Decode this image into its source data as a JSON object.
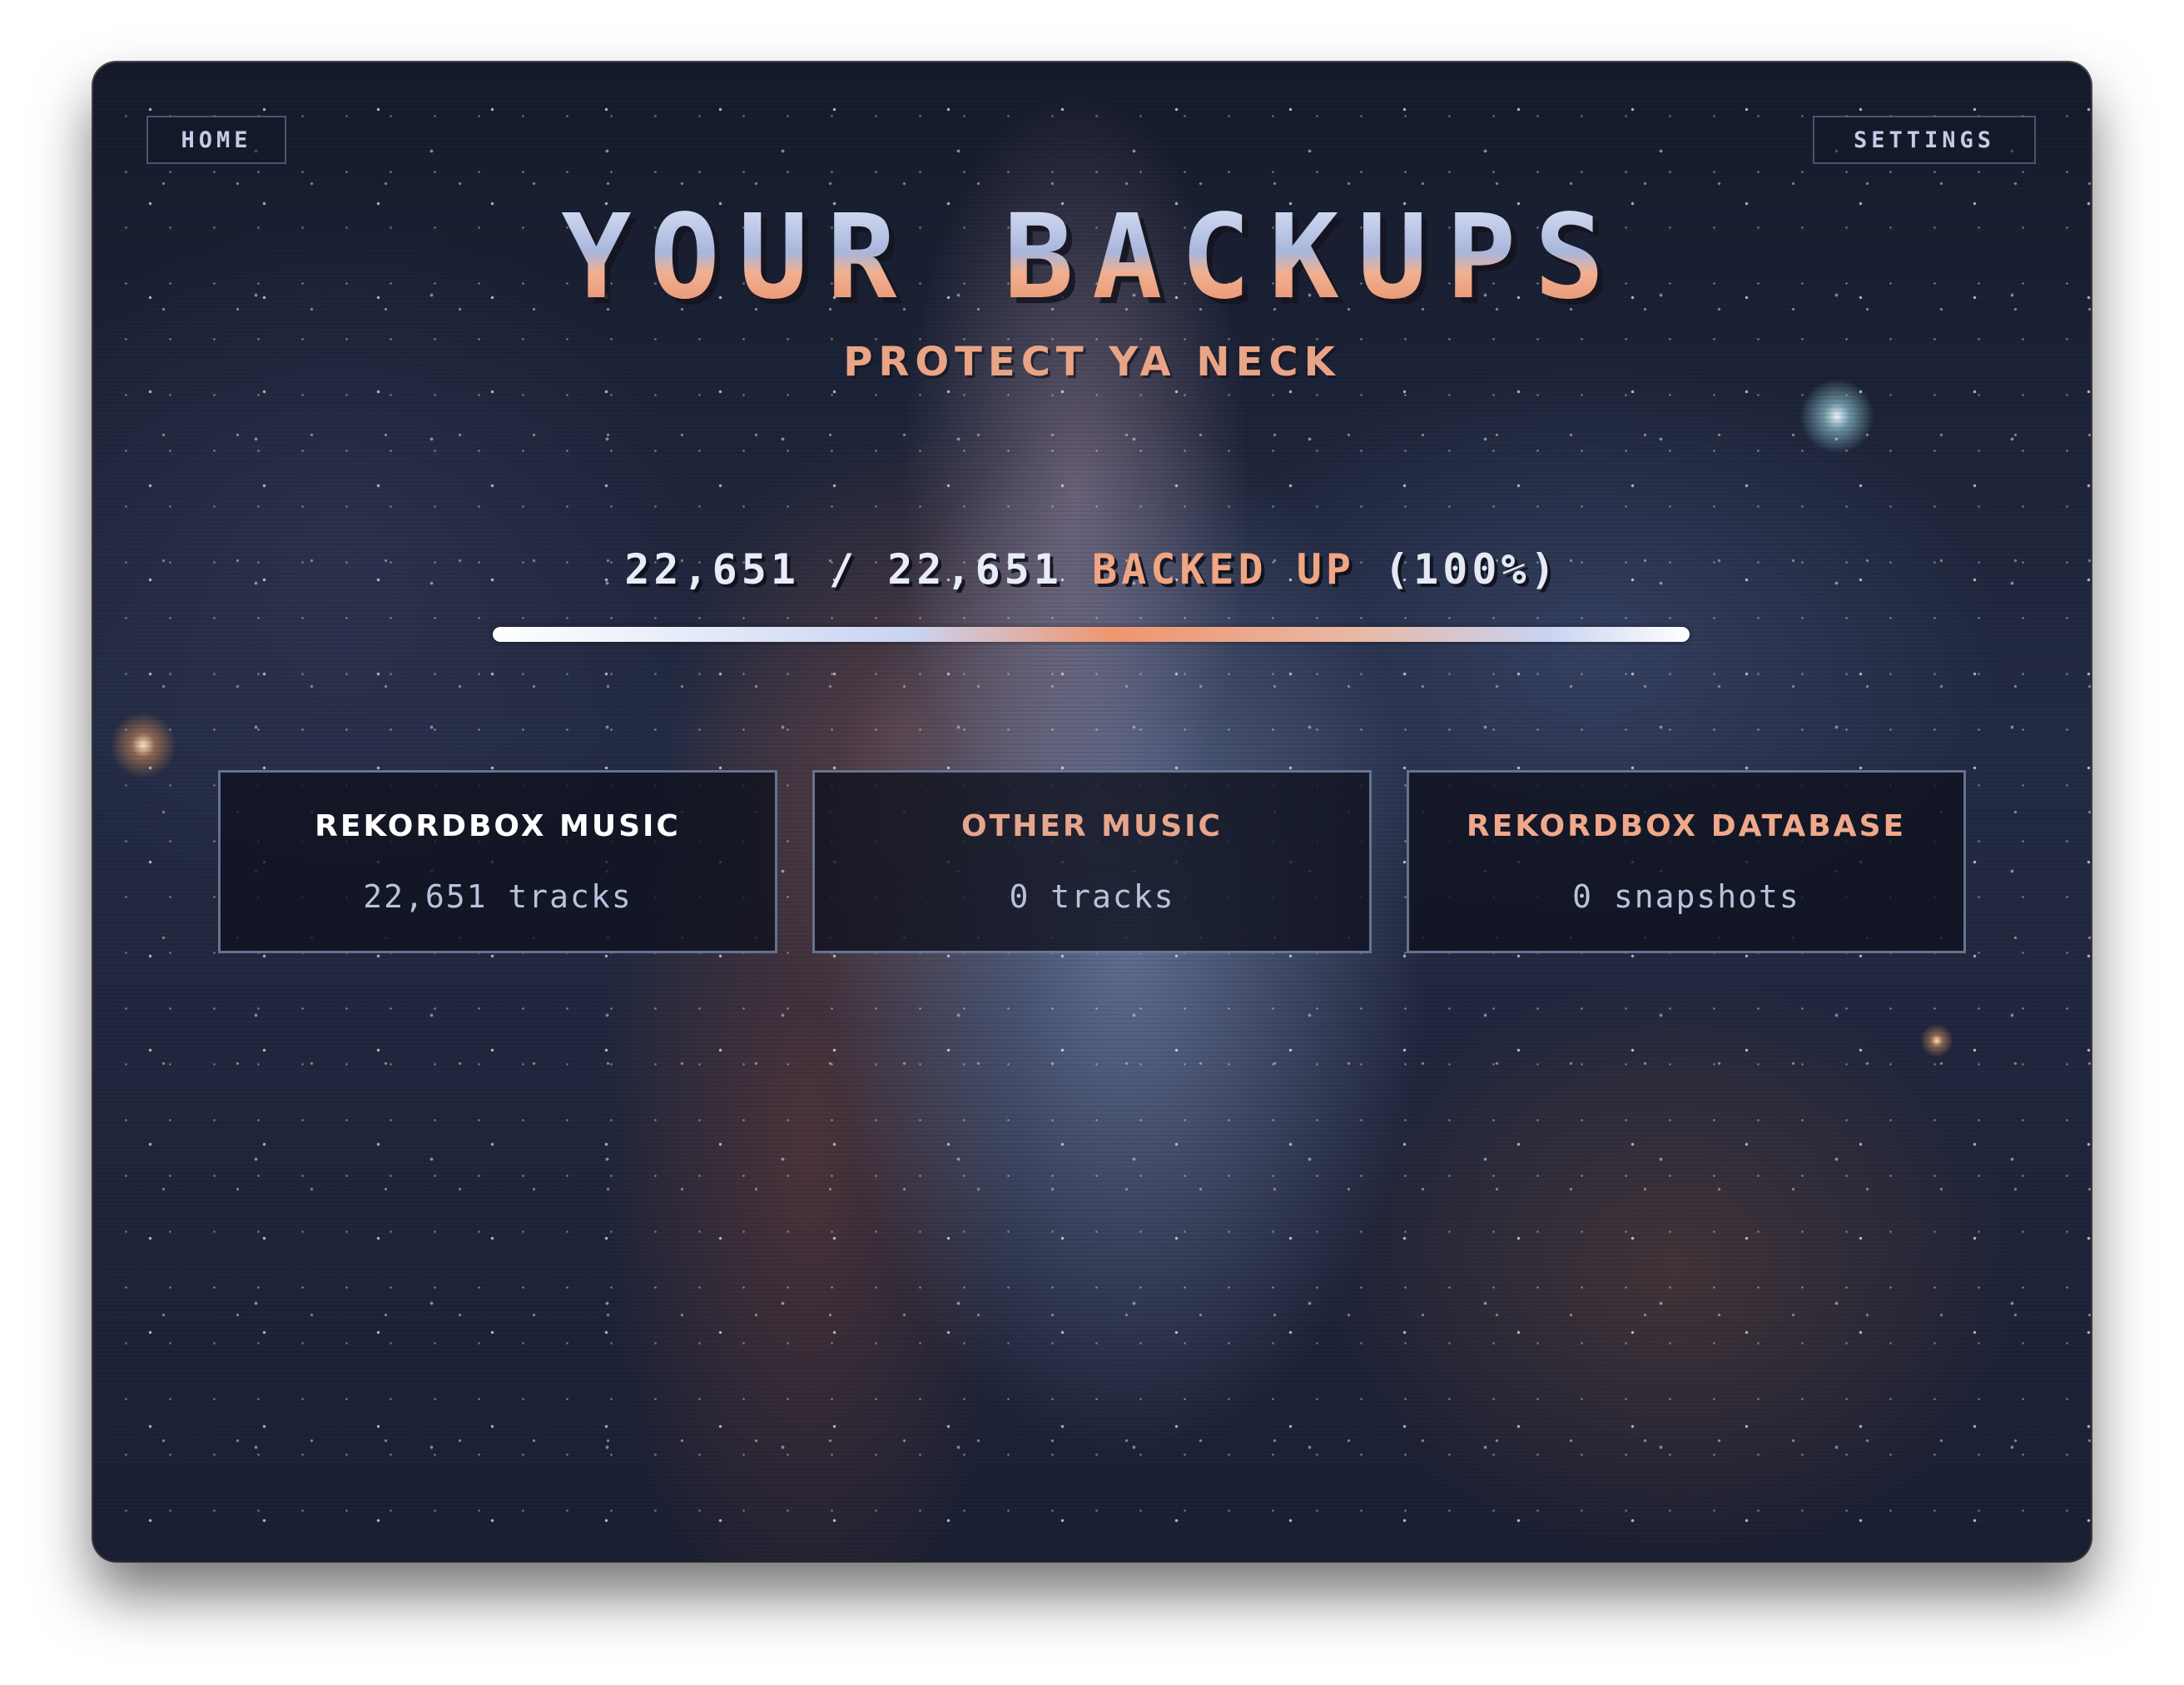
{
  "nav": {
    "home_label": "HOME",
    "settings_label": "SETTINGS"
  },
  "header": {
    "title": "YOUR BACKUPS",
    "subtitle": "PROTECT YA NECK"
  },
  "progress": {
    "backed_up_count": "22,651",
    "separator": "/",
    "total_count": "22,651",
    "status_word": "BACKED UP",
    "percent_text": "(100%)",
    "fraction": 1.0
  },
  "cards": [
    {
      "title": "REKORDBOX MUSIC",
      "value": "22,651 tracks",
      "title_color": "#ffffff"
    },
    {
      "title": "OTHER MUSIC",
      "value": "0 tracks",
      "title_color": "#e6a68c"
    },
    {
      "title": "REKORDBOX DATABASE",
      "value": "0 snapshots",
      "title_color": "#f0a88a"
    }
  ],
  "colors": {
    "accent_orange": "#e9a485",
    "accent_blue": "#c9d4f2",
    "card_border": "#8291b4"
  }
}
